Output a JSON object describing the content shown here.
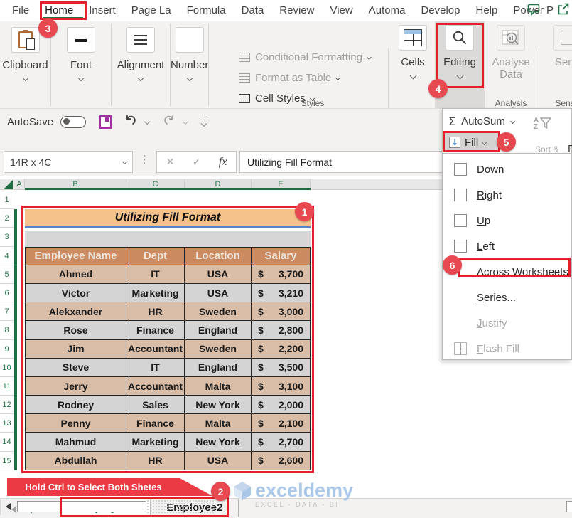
{
  "titlebar": {
    "tabs": [
      {
        "label": "File"
      },
      {
        "label": "Home",
        "state": "active"
      },
      {
        "label": "Insert"
      },
      {
        "label": "Page La"
      },
      {
        "label": "Formula"
      },
      {
        "label": "Data"
      },
      {
        "label": "Review"
      },
      {
        "label": "View"
      },
      {
        "label": "Automa"
      },
      {
        "label": "Develop"
      },
      {
        "label": "Help"
      },
      {
        "label": "Power P"
      }
    ]
  },
  "ribbon": {
    "collapsed_groups": [
      {
        "label": "Clipboard",
        "icon": "clipboard"
      },
      {
        "label": "Font",
        "icon": "font-a"
      },
      {
        "label": "Alignment",
        "icon": "align-lines"
      },
      {
        "label": "Number",
        "icon": "percent"
      }
    ],
    "styles": {
      "items": [
        {
          "label": "Conditional Formatting",
          "enabled": false
        },
        {
          "label": "Format as Table",
          "enabled": false
        },
        {
          "label": "Cell Styles",
          "enabled": true
        }
      ],
      "group_label": "Styles"
    },
    "cells_label": "Cells",
    "editing_label": "Editing",
    "analyse_line1": "Analyse",
    "analyse_line2": "Data",
    "analysis_group_label": "Analysis",
    "sensitivity_label": "Sens",
    "sensitivity_group_label": "Sens"
  },
  "quick_access": {
    "autosave_label": "AutoSave"
  },
  "formula_bar": {
    "name_box": "14R x 4C",
    "fx_label": "fx",
    "cancel_glyph": "✕",
    "enter_glyph": "✓",
    "formula": "Utilizing Fill Format"
  },
  "fill_panel": {
    "autosum_label": "AutoSum",
    "sigma": "Σ",
    "fill_label": "Fill",
    "sort_label": "Sort &",
    "find_partial": "F",
    "az_top": "A",
    "az_bottom": "Z",
    "menu": [
      {
        "label": "Down",
        "icon": "fill-down",
        "enabled": true
      },
      {
        "label": "Right",
        "icon": "fill-right",
        "enabled": true
      },
      {
        "label": "Up",
        "icon": "fill-up",
        "enabled": true
      },
      {
        "label": "Left",
        "icon": "fill-left",
        "enabled": true
      },
      {
        "label": "Across Worksheets...",
        "icon": "none",
        "enabled": true
      },
      {
        "label": "Series...",
        "icon": "none",
        "enabled": true
      },
      {
        "label": "Justify",
        "icon": "none",
        "enabled": false
      },
      {
        "label": "Flash Fill",
        "icon": "flash-fill",
        "enabled": false
      }
    ]
  },
  "grid": {
    "columns": [
      {
        "label": "A"
      },
      {
        "label": "B",
        "selected": true
      },
      {
        "label": "C",
        "selected": true
      },
      {
        "label": "D",
        "selected": true
      },
      {
        "label": "E",
        "selected": true
      }
    ],
    "rows": [
      "1",
      "2",
      "3",
      "4",
      "5",
      "6",
      "7",
      "8",
      "9",
      "10",
      "11",
      "12",
      "13",
      "14",
      "15"
    ]
  },
  "worksheet_table": {
    "title": "Utilizing Fill Format",
    "headers": [
      "Employee Name",
      "Dept",
      "Location",
      "Salary"
    ],
    "currency_symbol": "$",
    "rows": [
      {
        "name": "Ahmed",
        "dept": "IT",
        "location": "USA",
        "salary": "3,700"
      },
      {
        "name": "Victor",
        "dept": "Marketing",
        "location": "USA",
        "salary": "3,210"
      },
      {
        "name": "Alekxander",
        "dept": "HR",
        "location": "Sweden",
        "salary": "3,000"
      },
      {
        "name": "Rose",
        "dept": "Finance",
        "location": "England",
        "salary": "2,800"
      },
      {
        "name": "Jim",
        "dept": "Accountant",
        "location": "Sweden",
        "salary": "2,200"
      },
      {
        "name": "Steve",
        "dept": "IT",
        "location": "England",
        "salary": "3,500"
      },
      {
        "name": "Jerry",
        "dept": "Accountant",
        "location": "Malta",
        "salary": "3,100"
      },
      {
        "name": "Rodney",
        "dept": "Sales",
        "location": "New York",
        "salary": "2,000"
      },
      {
        "name": "Penny",
        "dept": "Finance",
        "location": "Malta",
        "salary": "2,100"
      },
      {
        "name": "Mahmud",
        "dept": "Marketing",
        "location": "New York",
        "salary": "2,700"
      },
      {
        "name": "Abdullah",
        "dept": "HR",
        "location": "USA",
        "salary": "2,600"
      }
    ]
  },
  "callout": {
    "text": "Hold Ctrl to Select Both Shetes"
  },
  "sheet_bar": {
    "tabs": [
      {
        "label": "Employee1",
        "state": "active"
      },
      {
        "label": "Employee2"
      }
    ]
  },
  "watermark": {
    "brand": "exceldemy",
    "tagline": "EXCEL - DATA - BI"
  },
  "annotations": {
    "step1": "1",
    "step2": "2",
    "step3": "3",
    "step4": "4",
    "step5": "5",
    "step6": "6"
  },
  "colors": {
    "excel_green": "#217346",
    "annotation_red": "#e3202c",
    "badge_red": "#e84850",
    "title_fill": "#f6c28c",
    "header_fill": "#cb8a60",
    "row_gray": "#d4d4d4",
    "row_tan": "#d9bda7",
    "fill_arrow_blue": "#2b77c0"
  }
}
